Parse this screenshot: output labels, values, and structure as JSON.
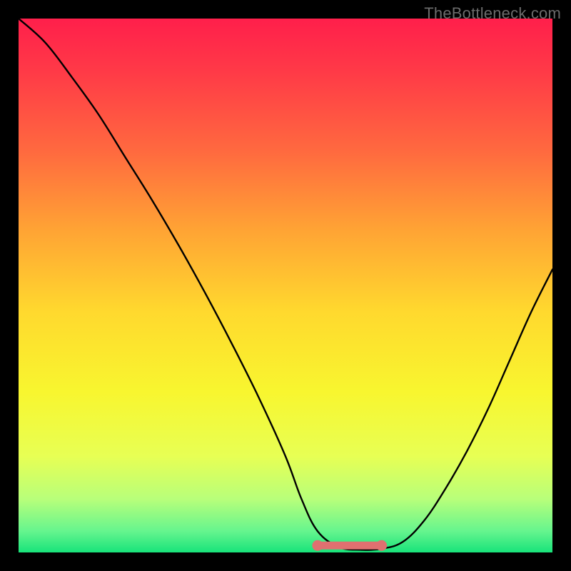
{
  "watermark": "TheBottleneck.com",
  "chart_data": {
    "type": "line",
    "title": "",
    "xlabel": "",
    "ylabel": "",
    "xlim": [
      0,
      100
    ],
    "ylim": [
      0,
      100
    ],
    "series": [
      {
        "name": "curve",
        "x": [
          0,
          5,
          10,
          15,
          20,
          25,
          30,
          35,
          40,
          45,
          50,
          53,
          56,
          60,
          64,
          68,
          72,
          76,
          80,
          84,
          88,
          92,
          96,
          100
        ],
        "values": [
          100,
          95.5,
          89,
          82,
          74,
          66,
          57.5,
          48.5,
          39,
          29,
          18,
          10,
          4,
          1,
          0.5,
          0.7,
          2,
          6,
          12,
          19,
          27,
          36,
          45,
          53
        ]
      }
    ],
    "highlight": {
      "name": "plateau-marker",
      "color": "#e07070",
      "x_start": 56,
      "x_end": 68,
      "y": 1.3
    },
    "gradient_stops": [
      {
        "pos": 0.0,
        "color": "#ff1f4b"
      },
      {
        "pos": 0.1,
        "color": "#ff3a47"
      },
      {
        "pos": 0.25,
        "color": "#ff6a3f"
      },
      {
        "pos": 0.4,
        "color": "#ffa534"
      },
      {
        "pos": 0.55,
        "color": "#ffd92e"
      },
      {
        "pos": 0.7,
        "color": "#f8f62f"
      },
      {
        "pos": 0.82,
        "color": "#e7ff54"
      },
      {
        "pos": 0.9,
        "color": "#b8ff7a"
      },
      {
        "pos": 0.96,
        "color": "#66f58e"
      },
      {
        "pos": 1.0,
        "color": "#18e37a"
      }
    ]
  }
}
